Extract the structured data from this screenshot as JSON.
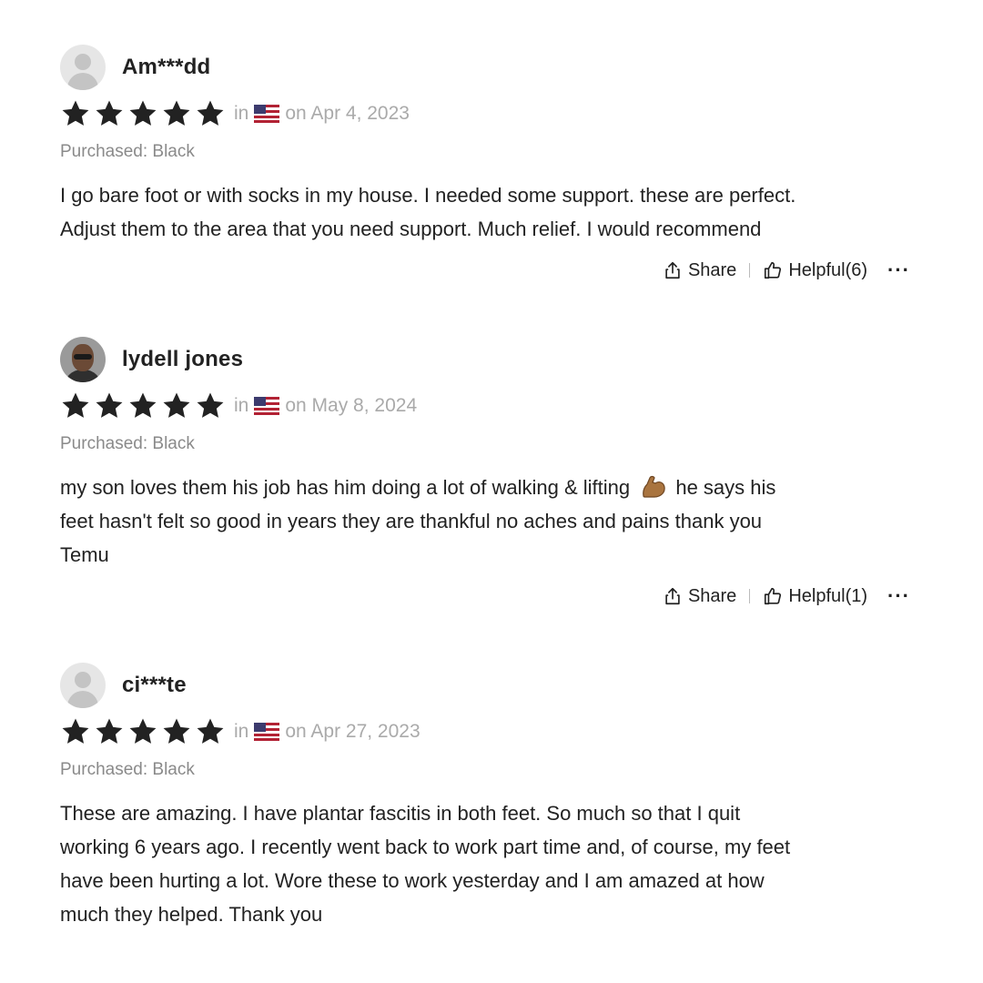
{
  "reviews": [
    {
      "name": "Am***dd",
      "avatar": "default-avatar",
      "rating": 5,
      "in_label": "in",
      "country_flag": "us-flag-icon",
      "date": "on Apr 4, 2023",
      "purchased": "Purchased: Black",
      "lines": [
        "I go bare foot or with socks in my house. I needed some support. these are perfect.",
        "Adjust them to the area that you need support. Much relief. I would recommend"
      ],
      "share_label": "Share",
      "helpful_label": "Helpful(6)",
      "more_label": "···"
    },
    {
      "name": "lydell jones",
      "avatar": "user-photo",
      "rating": 5,
      "in_label": "in",
      "country_flag": "us-flag-icon",
      "date": "on May 8, 2024",
      "purchased": "Purchased: Black",
      "line1_a": "my son loves them his job has him doing a lot of walking & lifting",
      "line1_emoji": "flexed-biceps-emoji",
      "line1_b": "he says his",
      "lines_after": [
        "feet hasn't felt so good in years they are thankful no aches and pains thank you",
        "Temu"
      ],
      "share_label": "Share",
      "helpful_label": "Helpful(1)",
      "more_label": "···"
    },
    {
      "name": "ci***te",
      "avatar": "default-avatar",
      "rating": 5,
      "in_label": "in",
      "country_flag": "us-flag-icon",
      "date": "on Apr 27, 2023",
      "purchased": "Purchased: Black",
      "lines": [
        "These are amazing. I have plantar fascitis in both feet. So much so that I quit",
        "working 6 years ago. I recently went back to work part time and, of course, my feet",
        "have been hurting a lot. Wore these to work yesterday and I am amazed at how",
        "much they helped. Thank you"
      ]
    }
  ],
  "colors": {
    "star": "#222222",
    "muted_text": "#aaaaaa",
    "purchased_text": "#8a8a8a"
  }
}
